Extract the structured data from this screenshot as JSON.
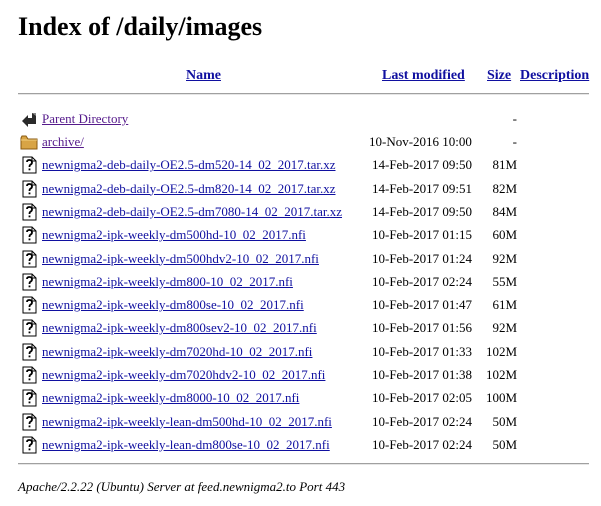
{
  "title": "Index of /daily/images",
  "columns": {
    "name": "Name",
    "last_modified": "Last modified",
    "size": "Size",
    "description": "Description"
  },
  "parent": {
    "label": "Parent Directory",
    "size": "-"
  },
  "rows": [
    {
      "icon": "folder-icon",
      "name": "archive/",
      "date": "10-Nov-2016 10:00",
      "size": "-"
    },
    {
      "icon": "unknown-file-icon",
      "name": "newnigma2-deb-daily-OE2.5-dm520-14_02_2017.tar.xz",
      "date": "14-Feb-2017 09:50",
      "size": "81M"
    },
    {
      "icon": "unknown-file-icon",
      "name": "newnigma2-deb-daily-OE2.5-dm820-14_02_2017.tar.xz",
      "date": "14-Feb-2017 09:51",
      "size": "82M"
    },
    {
      "icon": "unknown-file-icon",
      "name": "newnigma2-deb-daily-OE2.5-dm7080-14_02_2017.tar.xz",
      "date": "14-Feb-2017 09:50",
      "size": "84M"
    },
    {
      "icon": "unknown-file-icon",
      "name": "newnigma2-ipk-weekly-dm500hd-10_02_2017.nfi",
      "date": "10-Feb-2017 01:15",
      "size": "60M"
    },
    {
      "icon": "unknown-file-icon",
      "name": "newnigma2-ipk-weekly-dm500hdv2-10_02_2017.nfi",
      "date": "10-Feb-2017 01:24",
      "size": "92M"
    },
    {
      "icon": "unknown-file-icon",
      "name": "newnigma2-ipk-weekly-dm800-10_02_2017.nfi",
      "date": "10-Feb-2017 02:24",
      "size": "55M"
    },
    {
      "icon": "unknown-file-icon",
      "name": "newnigma2-ipk-weekly-dm800se-10_02_2017.nfi",
      "date": "10-Feb-2017 01:47",
      "size": "61M"
    },
    {
      "icon": "unknown-file-icon",
      "name": "newnigma2-ipk-weekly-dm800sev2-10_02_2017.nfi",
      "date": "10-Feb-2017 01:56",
      "size": "92M"
    },
    {
      "icon": "unknown-file-icon",
      "name": "newnigma2-ipk-weekly-dm7020hd-10_02_2017.nfi",
      "date": "10-Feb-2017 01:33",
      "size": "102M"
    },
    {
      "icon": "unknown-file-icon",
      "name": "newnigma2-ipk-weekly-dm7020hdv2-10_02_2017.nfi",
      "date": "10-Feb-2017 01:38",
      "size": "102M"
    },
    {
      "icon": "unknown-file-icon",
      "name": "newnigma2-ipk-weekly-dm8000-10_02_2017.nfi",
      "date": "10-Feb-2017 02:05",
      "size": "100M"
    },
    {
      "icon": "unknown-file-icon",
      "name": "newnigma2-ipk-weekly-lean-dm500hd-10_02_2017.nfi",
      "date": "10-Feb-2017 02:24",
      "size": "50M"
    },
    {
      "icon": "unknown-file-icon",
      "name": "newnigma2-ipk-weekly-lean-dm800se-10_02_2017.nfi",
      "date": "10-Feb-2017 02:24",
      "size": "50M"
    }
  ],
  "footer": "Apache/2.2.22 (Ubuntu) Server at feed.newnigma2.to Port 443"
}
